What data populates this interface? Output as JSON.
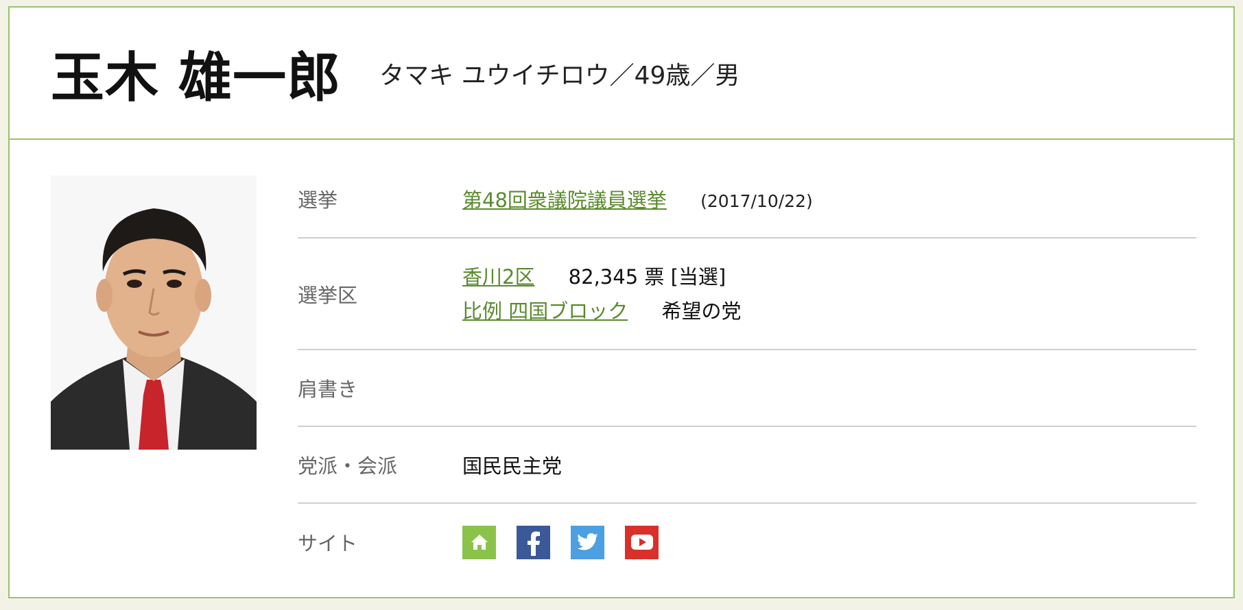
{
  "candidate": {
    "name": "玉木 雄一郎",
    "kana_age_gender": "タマキ ユウイチロウ／49歳／男"
  },
  "rows": {
    "election": {
      "label": "選挙",
      "link_text": "第48回衆議院議員選挙",
      "date": "(2017/10/22)"
    },
    "district": {
      "label": "選挙区",
      "district_link": "香川2区",
      "votes": "82,345 票 [当選]",
      "pr_link": "比例 四国ブロック",
      "pr_party": "希望の党"
    },
    "title": {
      "label": "肩書き"
    },
    "party": {
      "label": "党派・会派",
      "value": "国民民主党"
    },
    "sites": {
      "label": "サイト",
      "icons": [
        {
          "name": "home-icon",
          "color": "#8bc34a"
        },
        {
          "name": "facebook-icon",
          "color": "#3b5998"
        },
        {
          "name": "twitter-icon",
          "color": "#4c9fe0"
        },
        {
          "name": "youtube-icon",
          "color": "#d9302a"
        }
      ]
    }
  },
  "colors": {
    "accent_green": "#9ac26a",
    "link_green": "#5a8a2e",
    "page_bg": "#f3f2e7"
  }
}
